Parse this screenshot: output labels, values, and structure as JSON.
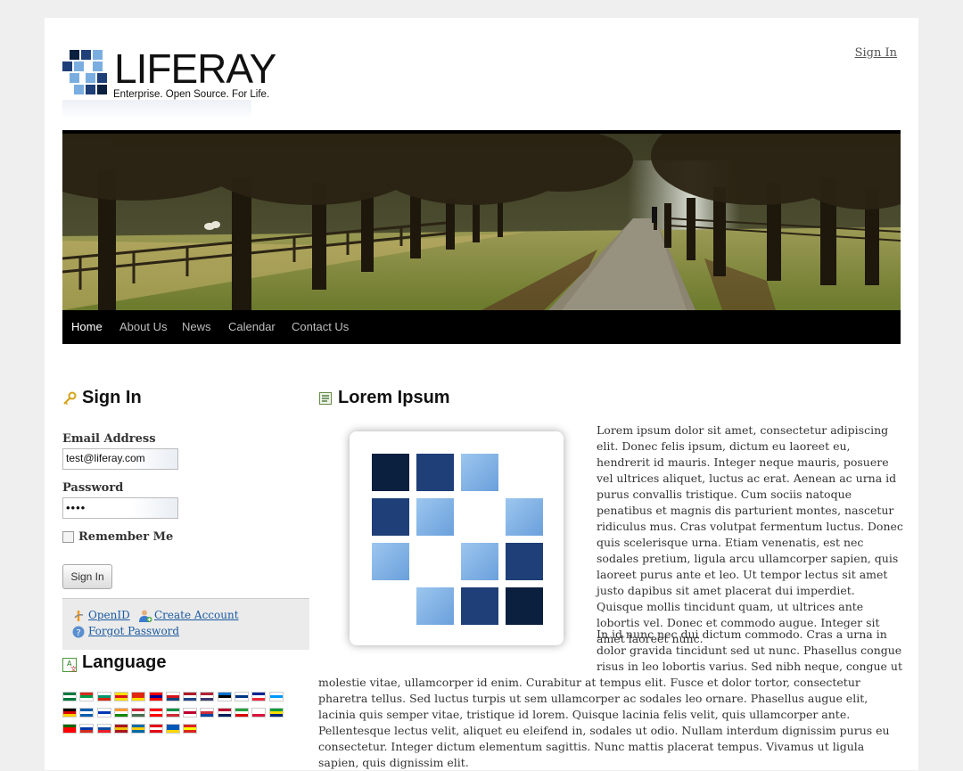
{
  "header": {
    "logo_word": "LIFERAY",
    "logo_tagline": "Enterprise. Open Source. For Life.",
    "sign_in_link": "Sign In"
  },
  "nav": {
    "items": [
      {
        "label": "Home",
        "active": true
      },
      {
        "label": "About Us"
      },
      {
        "label": "News"
      },
      {
        "label": "Calendar"
      },
      {
        "label": "Contact Us"
      }
    ]
  },
  "sign_in_portlet": {
    "title": "Sign In",
    "email_label": "Email Address",
    "email_value": "test@liferay.com",
    "password_label": "Password",
    "password_value": "••••",
    "remember_me_label": "Remember Me",
    "submit_label": "Sign In",
    "links": {
      "openid": "OpenID",
      "create_account": "Create Account",
      "forgot_password": "Forgot Password"
    }
  },
  "language_portlet": {
    "title": "Language",
    "flags": [
      "ar",
      "eu",
      "bg",
      "ca",
      "zh-cn",
      "zh-tw",
      "cs",
      "nl",
      "en",
      "et",
      "fi",
      "fr",
      "gl",
      "de",
      "el",
      "iw",
      "hi",
      "hu",
      "in",
      "it",
      "ja",
      "ko",
      "nb",
      "fa",
      "pl",
      "pt-br",
      "pt",
      "ru",
      "sk",
      "es",
      "sv",
      "tr",
      "uk",
      "vi"
    ]
  },
  "content": {
    "title": "Lorem Ipsum",
    "para1": "Lorem ipsum dolor sit amet, consectetur adipiscing elit. Donec felis ipsum, dictum eu laoreet eu, hendrerit id mauris. Integer neque mauris, posuere vel ultrices aliquet, luctus ac erat. Aenean ac urna id purus convallis tristique. Cum sociis natoque penatibus et magnis dis parturient montes, nascetur ridiculus mus. Cras volutpat fermentum luctus. Donec quis scelerisque urna. Etiam venenatis, est nec sodales pretium, ligula arcu ullamcorper sapien, quis laoreet purus ante et leo. Ut tempor lectus sit amet justo dapibus sit amet placerat dui imperdiet. Quisque mollis tincidunt quam, ut ultrices ante lobortis vel. Donec et commodo augue. Integer sit amet laoreet nunc.",
    "para2": "In id nunc nec dui dictum commodo. Cras a urna in dolor gravida tincidunt sed ut nunc. Phasellus congue risus in leo lobortis varius. Sed nibh neque, congue ut molestie vitae, ullamcorper id enim. Curabitur at tempus elit. Fusce et dolor tortor, consectetur pharetra tellus. Sed luctus turpis ut sem ullamcorper ac sodales leo ornare. Phasellus augue elit, lacinia quis semper vitae, tristique id lorem. Quisque lacinia felis velit, quis ullamcorper ante. Pellentesque lectus velit, aliquet eu eleifend in, sodales ut odio. Nullam interdum dignissim purus eu consectetur. Integer dictum elementum sagittis. Nunc mattis placerat tempus. Vivamus ut ligula sapien, quis dignissim elit."
  },
  "colors": {
    "nav_bg": "#000000",
    "link": "#1a5aa0",
    "logo_dark": "#0b1f3f",
    "logo_mid": "#1e3f78",
    "logo_light": "#7aaee0"
  }
}
